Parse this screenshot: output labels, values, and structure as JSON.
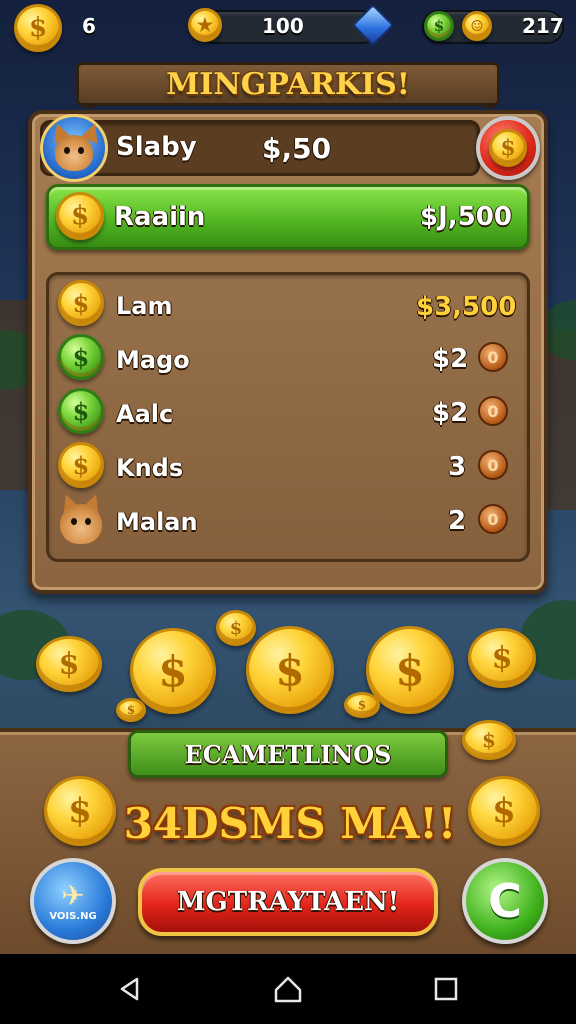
{
  "hud": {
    "coins": "6",
    "stars": "100",
    "level": "217"
  },
  "sign": {
    "title": "MINGPARKIS!"
  },
  "player": {
    "name": "Slaby",
    "amount": "$,50"
  },
  "highlight": {
    "name": "Raaiin",
    "amount": "$J,500"
  },
  "leaderboard": [
    {
      "name": "Lam",
      "value": "$3,500",
      "badge": "",
      "icon": "gold-coin"
    },
    {
      "name": "Mago",
      "value": "$2",
      "badge": "0",
      "icon": "green-coin"
    },
    {
      "name": "Aalc",
      "value": "$2",
      "badge": "0",
      "icon": "green-coin"
    },
    {
      "name": "Knds",
      "value": "3",
      "badge": "0",
      "icon": "gold-coin"
    },
    {
      "name": "Malan",
      "value": "2",
      "badge": "0",
      "icon": "fox-avatar"
    }
  ],
  "bottom": {
    "label": "ECAMETLINOS",
    "headline": "34DSMS MA!!",
    "action_button": "MGTRAYTAEN!",
    "left_button_caption": "VOIS.NG"
  },
  "colors": {
    "gold": "#ffd23a",
    "green": "#53b823",
    "red": "#e3241a",
    "wood": "#8c6440"
  }
}
